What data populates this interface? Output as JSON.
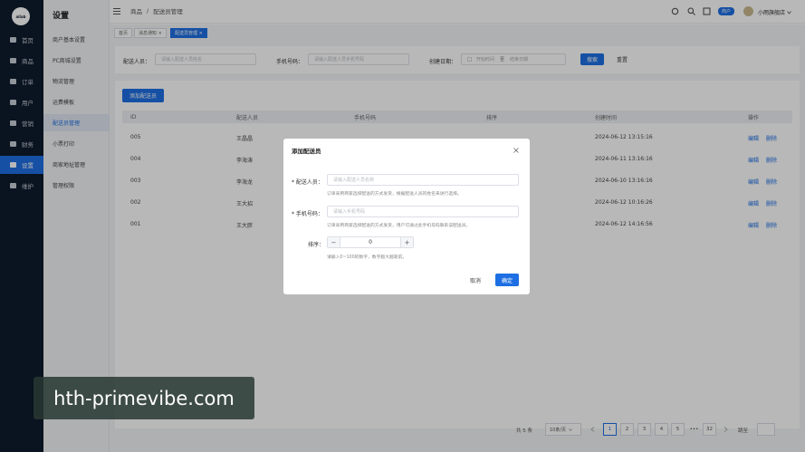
{
  "sidebar": {
    "logo_text": "ailab",
    "items": [
      {
        "label": "首页",
        "icon": "home-icon"
      },
      {
        "label": "商品",
        "icon": "goods-icon"
      },
      {
        "label": "订单",
        "icon": "order-icon"
      },
      {
        "label": "用户",
        "icon": "user-icon"
      },
      {
        "label": "营销",
        "icon": "marketing-icon"
      },
      {
        "label": "财务",
        "icon": "finance-icon"
      },
      {
        "label": "设置",
        "icon": "settings-icon"
      },
      {
        "label": "维护",
        "icon": "maintenance-icon"
      }
    ]
  },
  "submenu": {
    "title": "设置",
    "items": [
      "商户基本设置",
      "PC商城设置",
      "物流管理",
      "运费模板",
      "配送员管理",
      "小票打印",
      "商家地址管理",
      "管理权限"
    ]
  },
  "header": {
    "breadcrumb_parent": "商品",
    "breadcrumb_sep": "/",
    "breadcrumb_current": "配送员管理",
    "badge": "商户",
    "store_name": "小雨旗舰店"
  },
  "tabs": [
    {
      "label": "首页"
    },
    {
      "label": "消息通知 ×"
    },
    {
      "label": "配送员管理 ×"
    }
  ],
  "filters": {
    "courier_label": "配送人员：",
    "courier_placeholder": "请输入配送人员姓名",
    "phone_label": "手机号码：",
    "phone_placeholder": "请输入配送人员手机号码",
    "date_label": "创建日期：",
    "date_start": "开始时间",
    "date_sep": "至",
    "date_end": "结束日期",
    "search_btn": "搜索",
    "reset_btn": "重置"
  },
  "add_button": "添加配送员",
  "table": {
    "columns": [
      "ID",
      "配送人员",
      "手机号码",
      "排序",
      "创建时间",
      "操作"
    ],
    "rows": [
      {
        "id": "005",
        "name": "王晶晶",
        "time": "2024-06-12 13:15:16"
      },
      {
        "id": "004",
        "name": "李海涛",
        "time": "2024-06-11 13:16:16"
      },
      {
        "id": "003",
        "name": "李海龙",
        "time": "2024-06-10 13:16:16"
      },
      {
        "id": "002",
        "name": "王大招",
        "time": "2024-06-12 10:16:26"
      },
      {
        "id": "001",
        "name": "王大胖",
        "time": "2024-06-12 14:16:56"
      }
    ],
    "edit_label": "编辑",
    "delete_label": "删除"
  },
  "modal": {
    "title": "添加配送员",
    "name_label": "* 配送人员：",
    "name_placeholder": "请输入配送人员名称",
    "name_hint": "订单采用商家选择配送的方式发货，根据配送人员的姓名来进行选择。",
    "phone_label": "* 手机号码：",
    "phone_placeholder": "请输入手机号码",
    "phone_hint": "订单采用商家选择配送的方式发货，用户可通过此手机号码联系该配送员。",
    "sort_label": "排序：",
    "sort_value": "0",
    "minus": "−",
    "plus": "+",
    "sort_hint": "请输入0~100的数字，数字越大越靠前。",
    "cancel_btn": "取消",
    "confirm_btn": "确定"
  },
  "pagination": {
    "total": "共 5 条",
    "page_size": "10条/页",
    "pages": [
      "1",
      "2",
      "3",
      "4",
      "5",
      "•••",
      "32"
    ],
    "goto_label": "跳至"
  },
  "watermark": "hth-primevibe.com",
  "colors": {
    "primary": "#1e6fe3",
    "sidebar": "#0f1b2d"
  }
}
